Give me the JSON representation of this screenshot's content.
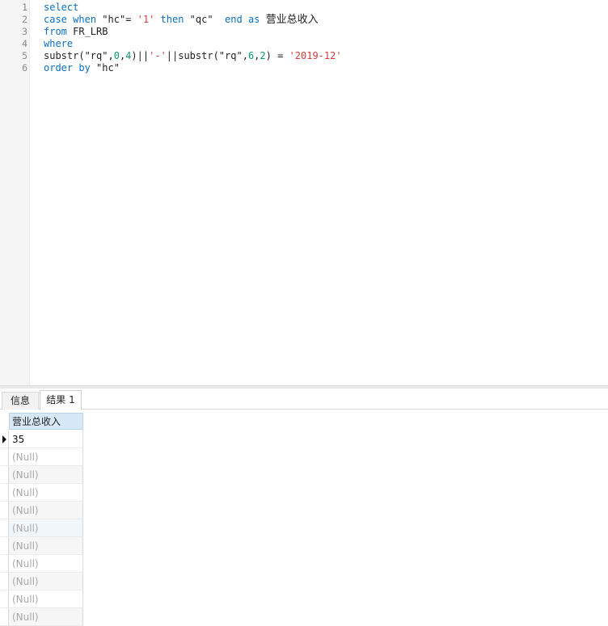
{
  "editor": {
    "line_numbers": [
      "1",
      "2",
      "3",
      "4",
      "5",
      "6"
    ],
    "lines": [
      [
        {
          "t": "select",
          "c": "kw"
        }
      ],
      [
        {
          "t": "case",
          "c": "kw"
        },
        {
          "t": " "
        },
        {
          "t": "when",
          "c": "kw"
        },
        {
          "t": " \"hc\"= "
        },
        {
          "t": "'1'",
          "c": "str"
        },
        {
          "t": " "
        },
        {
          "t": "then",
          "c": "kw"
        },
        {
          "t": " \"qc\"  "
        },
        {
          "t": "end",
          "c": "kw"
        },
        {
          "t": " "
        },
        {
          "t": "as",
          "c": "kw"
        },
        {
          "t": " "
        },
        {
          "t": "营业总收入",
          "c": "cjk"
        }
      ],
      [
        {
          "t": "from",
          "c": "kw"
        },
        {
          "t": " FR_LRB"
        }
      ],
      [
        {
          "t": "where",
          "c": "kw"
        }
      ],
      [
        {
          "t": "substr(\"rq\","
        },
        {
          "t": "0",
          "c": "num"
        },
        {
          "t": ","
        },
        {
          "t": "4",
          "c": "num"
        },
        {
          "t": ")||"
        },
        {
          "t": "'-'",
          "c": "str"
        },
        {
          "t": "||substr(\"rq\","
        },
        {
          "t": "6",
          "c": "num"
        },
        {
          "t": ","
        },
        {
          "t": "2",
          "c": "num"
        },
        {
          "t": ") = "
        },
        {
          "t": "'2019-12'",
          "c": "str"
        }
      ],
      [
        {
          "t": "order",
          "c": "kw"
        },
        {
          "t": " "
        },
        {
          "t": "by",
          "c": "kw"
        },
        {
          "t": " \"hc\""
        }
      ]
    ]
  },
  "tabs": {
    "info_label": "信息",
    "result_label": "结果 1"
  },
  "grid": {
    "column_header": "营业总收入",
    "rows": [
      "35",
      "(Null)",
      "(Null)",
      "(Null)",
      "(Null)",
      "(Null)",
      "(Null)",
      "(Null)",
      "(Null)",
      "(Null)",
      "(Null)"
    ]
  },
  "colors": {
    "keyword": "#0b6fc2",
    "string": "#d63a3a",
    "number": "#0a9a6a",
    "header_bg": "#d7e8f7"
  }
}
